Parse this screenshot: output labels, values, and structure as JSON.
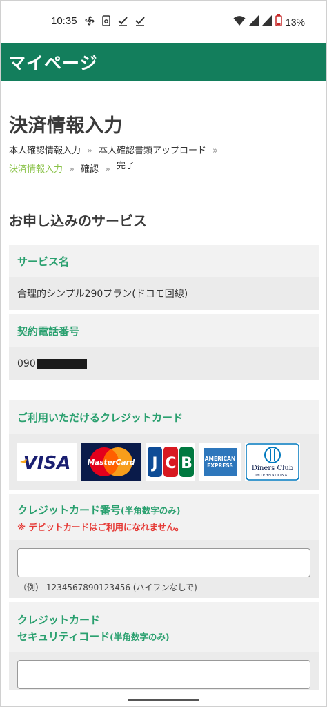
{
  "status_bar": {
    "time": "10:35",
    "battery": "13%",
    "icons": [
      "fan-icon",
      "sim-icon",
      "check-icon",
      "check-icon",
      "wifi-icon",
      "signal-icon",
      "signal-icon",
      "battery-icon"
    ]
  },
  "app_bar": {
    "title": "マイページ"
  },
  "page": {
    "title": "決済情報入力",
    "breadcrumbs": {
      "step1": "本人確認情報入力",
      "step2": "本人確認書類アップロード",
      "step3": "決済情報入力",
      "step4": "確認",
      "step5": "完了",
      "sep": "»"
    },
    "section_title": "お申し込みのサービス"
  },
  "service": {
    "name_label": "サービス名",
    "name_value": "合理的シンプル290プラン(ドコモ回線)",
    "phone_label": "契約電話番号",
    "phone_prefix": "090"
  },
  "cards": {
    "label": "ご利用いただけるクレジットカード",
    "brands": [
      "VISA",
      "MasterCard",
      "JCB",
      "AMERICAN EXPRESS",
      "Diners Club INTERNATIONAL"
    ]
  },
  "card_number": {
    "label": "クレジットカード番号",
    "label_note": "(半角数字のみ)",
    "warning": "※ デビットカードはご利用になれません。",
    "example": "（例） 1234567890123456 (ハイフンなしで)"
  },
  "security_code": {
    "label_line1": "クレジットカード",
    "label_line2": "セキュリティコード",
    "label_note": "(半角数字のみ)"
  },
  "colors": {
    "brand_green": "#137e5c",
    "label_green": "#2aa06f",
    "active_crumb": "#8bc34a",
    "warning_red": "#e53935"
  }
}
